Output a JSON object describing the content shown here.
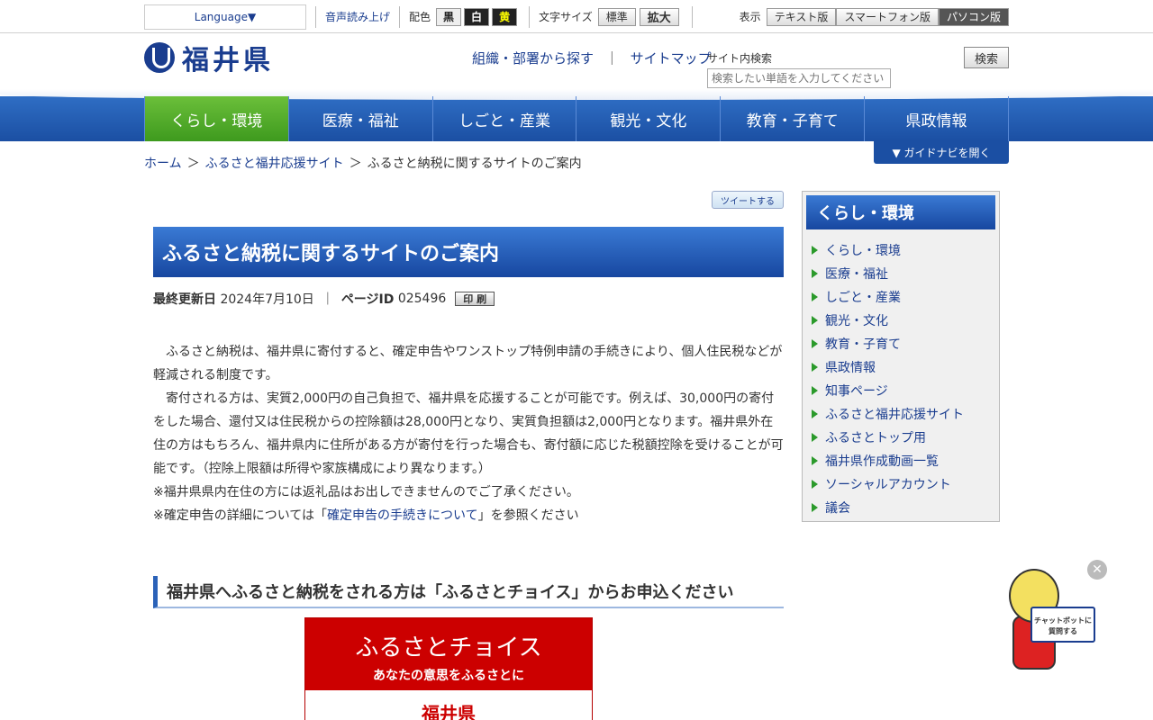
{
  "utility": {
    "language": "Language▼",
    "voice": "音声読み上げ",
    "color_label": "配色",
    "color_black": "黒",
    "color_white": "白",
    "color_yellow": "黄",
    "fontsize_label": "文字サイズ",
    "font_normal": "標準",
    "font_large": "拡大",
    "view_label": "表示",
    "view_text": "テキスト版",
    "view_smart": "スマートフォン版",
    "view_pc": "パソコン版"
  },
  "header": {
    "logo_text": "福井県",
    "link_org": "組織・部署から探す",
    "link_sep": "｜",
    "link_sitemap": "サイトマップ",
    "search_label": "サイト内検索",
    "search_placeholder": "検索したい単語を入力してください",
    "search_button": "検索"
  },
  "nav": [
    "くらし・環境",
    "医療・福祉",
    "しごと・産業",
    "観光・文化",
    "教育・子育て",
    "県政情報"
  ],
  "breadcrumb": {
    "home": "ホーム",
    "parent": "ふるさと福井応援サイト",
    "current": "ふるさと納税に関するサイトのご案内",
    "sep": "＞"
  },
  "guide_nav": "▼ ガイドナビを開く",
  "tweet": "ツイートする",
  "page": {
    "title": "ふるさと納税に関するサイトのご案内",
    "updated_label": "最終更新日",
    "updated_value": "2024年7月10日",
    "meta_sep": "｜",
    "pageid_label": "ページID",
    "pageid_value": "025496",
    "print": "印 刷",
    "para1": "　ふるさと納税は、福井県に寄付すると、確定申告やワンストップ特例申請の手続きにより、個人住民税などが軽減される制度です。",
    "para2": "　寄付される方は、実質2,000円の自己負担で、福井県を応援することが可能です。例えば、30,000円の寄付をした場合、還付又は住民税からの控除額は28,000円となり、実質負担額は2,000円となります。福井県外在住の方はもちろん、福井県内に住所がある方が寄付を行った場合も、寄付額に応じた税額控除を受けることが可能です。（控除上限額は所得や家族構成により異なります。）",
    "note1": "※福井県県内在住の方には返礼品はお出しできませんのでご了承ください。",
    "note2_pre": "※確定申告の詳細については「",
    "note2_link": "確定申告の手続きについて",
    "note2_post": "」を参照ください",
    "h2": "福井県へふるさと納税をされる方は「ふるさとチョイス」からお申込ください",
    "banner_title": "ふるさとチョイス",
    "banner_sub": "あなたの意思をふるさとに",
    "banner_pref": "福井県"
  },
  "sidebar": {
    "title": "くらし・環境",
    "items": [
      "くらし・環境",
      "医療・福祉",
      "しごと・産業",
      "観光・文化",
      "教育・子育て",
      "県政情報",
      "知事ページ",
      "ふるさと福井応援サイト",
      "ふるさとトップ用",
      "福井県作成動画一覧",
      "ソーシャルアカウント",
      "議会"
    ]
  },
  "chatbot": {
    "close": "✕",
    "sign": "チャットボットに質問する"
  }
}
